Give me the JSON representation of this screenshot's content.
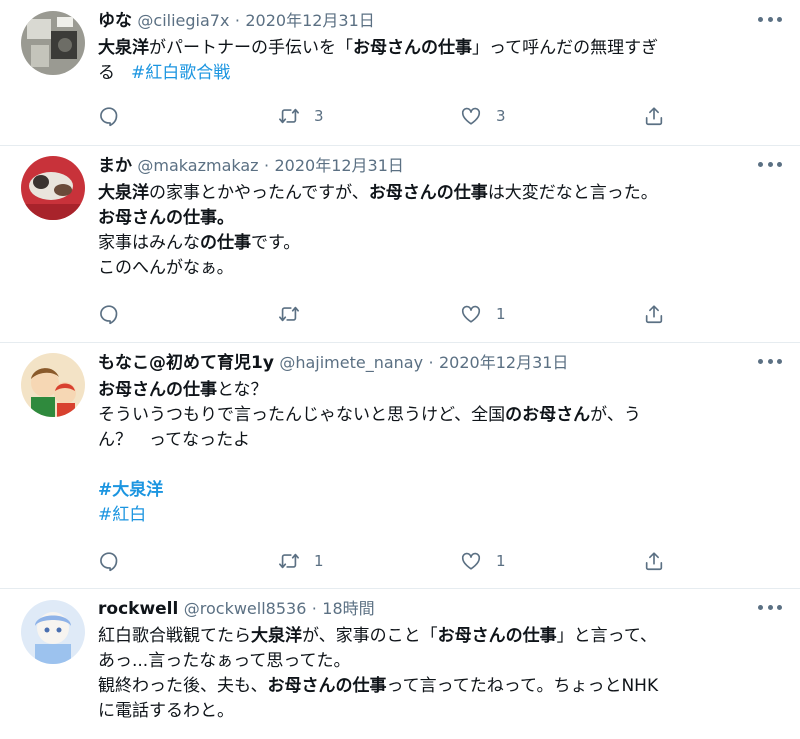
{
  "tweets": [
    {
      "name": "ゆな",
      "handle": "@ciliegia7x",
      "dot": "·",
      "time": "2020年12月31日",
      "lines": [
        [
          {
            "t": "大泉洋",
            "s": "b"
          },
          {
            "t": "がパートナーの手伝いを「"
          },
          {
            "t": "お母さんの仕事",
            "s": "b"
          },
          {
            "t": "」って呼んだの無理すぎ"
          }
        ],
        [
          {
            "t": "る"
          },
          {
            "t": "#紅白歌合戦",
            "s": "tag"
          }
        ]
      ],
      "retweets": "3",
      "likes": "3"
    },
    {
      "name": "まか",
      "handle": "@makazmakaz",
      "dot": "·",
      "time": "2020年12月31日",
      "lines": [
        [
          {
            "t": "大泉洋",
            "s": "b"
          },
          {
            "t": "の"
          },
          {
            "t": "家事とかやったんですが、"
          },
          {
            "t": "お母さんの仕事",
            "s": "b"
          },
          {
            "t": "は大変だなと言った。"
          }
        ],
        [
          {
            "t": "お母さんの仕事",
            "s": "b"
          },
          {
            "t": "。",
            "s": "b"
          }
        ],
        [
          {
            "t": "家事はみんな"
          },
          {
            "t": "の仕事",
            "s": "b"
          },
          {
            "t": "です。"
          }
        ],
        [
          {
            "t": "このへんがなぁ。"
          }
        ]
      ],
      "retweets": "",
      "likes": "1"
    },
    {
      "name": "もなこ@初めて育児1y",
      "handle": "@hajimete_nanay",
      "dot": "·",
      "time": "2020年12月31日",
      "lines": [
        [
          {
            "t": "お母さんの仕事",
            "s": "b"
          },
          {
            "t": "とな？"
          }
        ],
        [
          {
            "t": "そういうつもりで言ったんじゃないと思うけど、全国"
          },
          {
            "t": "のお母さん",
            "s": "b"
          },
          {
            "t": "が、う"
          }
        ],
        [
          {
            "t": "ん？　ってなったよ"
          }
        ],
        [],
        [
          {
            "t": "#大泉洋",
            "s": "tag b"
          }
        ],
        [
          {
            "t": "#紅白",
            "s": "tag"
          }
        ]
      ],
      "retweets": "1",
      "likes": "1"
    },
    {
      "name": "rockwell",
      "handle": "@rockwell8536",
      "dot": "·",
      "time": "18時間",
      "lines": [
        [
          {
            "t": "紅白歌合戦観てたら"
          },
          {
            "t": "大泉洋",
            "s": "b"
          },
          {
            "t": "が、家事のこと「"
          },
          {
            "t": "お母さんの仕事",
            "s": "b"
          },
          {
            "t": "」と言って、"
          }
        ],
        [
          {
            "t": "あっ...言ったなぁって思ってた。"
          }
        ],
        [
          {
            "t": "観終わった後、夫も、"
          },
          {
            "t": "お母さんの仕事",
            "s": "b"
          },
          {
            "t": "って言ってたねって。ちょっとNHK"
          }
        ],
        [
          {
            "t": "に電話するわと。"
          }
        ]
      ],
      "retweets": "",
      "likes": ""
    }
  ],
  "colors": {
    "text": "#0f1419",
    "muted": "#5b7083",
    "link": "#1b95e0",
    "divider": "#e6ecf0"
  },
  "icons": [
    "reply-icon",
    "retweet-icon",
    "like-icon",
    "share-icon",
    "more-icon"
  ]
}
